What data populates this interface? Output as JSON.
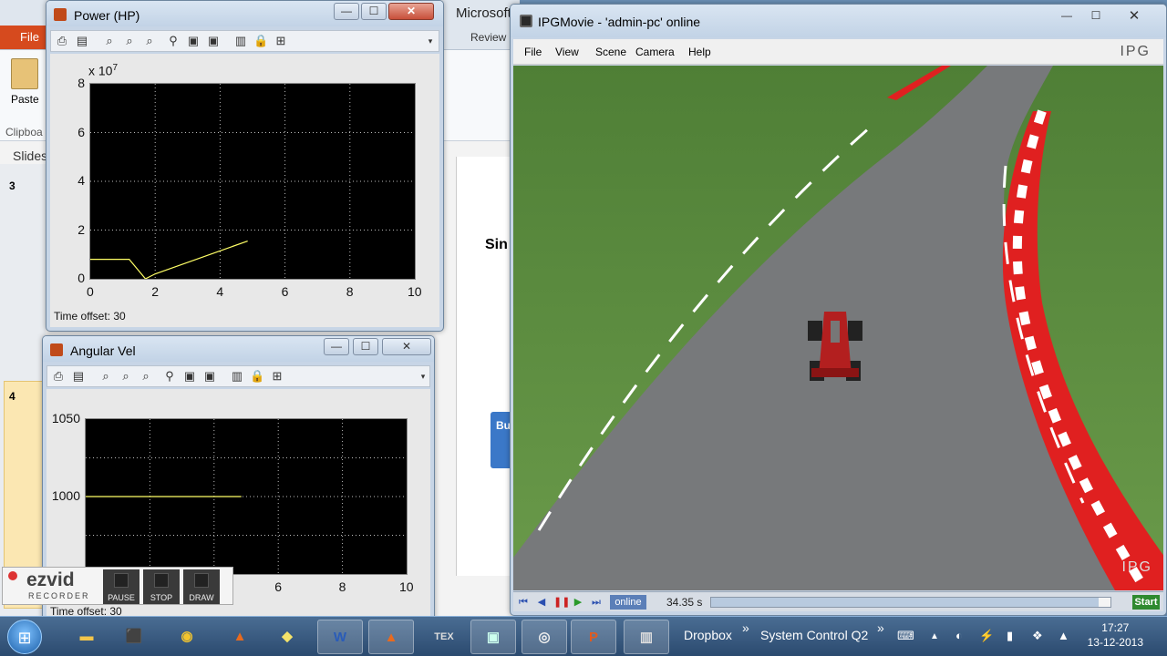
{
  "powerpoint": {
    "title_fragment": "Microsoft",
    "file_tab": "File",
    "review_tab": "Review",
    "paste_label": "Paste",
    "clipboard_group": "Clipboa",
    "slides_panel": "Slides",
    "slide_numbers": [
      "3",
      "4"
    ],
    "slide_heading_fragment": "Sin",
    "selected_box_text": "Bu"
  },
  "power_window": {
    "title": "Power (HP)",
    "exponent_label": "x 10",
    "exponent_power": "7",
    "status": "Time offset:  30",
    "chart_data": {
      "type": "line",
      "title": "",
      "xlabel": "",
      "ylabel": "",
      "xlim": [
        0,
        10
      ],
      "ylim": [
        0,
        8
      ],
      "xticks": [
        "0",
        "2",
        "4",
        "6",
        "8",
        "10"
      ],
      "yticks": [
        "0",
        "2",
        "4",
        "6",
        "8"
      ],
      "grid": true,
      "series": [
        {
          "color": "#ffff66",
          "x": [
            0,
            1.2,
            1.7,
            2.0,
            4.85
          ],
          "y": [
            0.8,
            0.8,
            0.0,
            0.2,
            1.55
          ]
        }
      ]
    }
  },
  "angular_window": {
    "title": "Angular Vel",
    "status": "Time offset:  30",
    "chart_data": {
      "type": "line",
      "title": "",
      "xlabel": "",
      "ylabel": "",
      "xlim": [
        0,
        10
      ],
      "ylim": [
        950,
        1050
      ],
      "xticks": [
        "6",
        "8",
        "10"
      ],
      "yticks": [
        "1000",
        "1050"
      ],
      "grid": true,
      "series": [
        {
          "color": "#ffff66",
          "x": [
            0,
            4.85
          ],
          "y": [
            1000,
            1000
          ]
        }
      ]
    }
  },
  "ipg": {
    "title": "IPGMovie - 'admin-pc' online",
    "menu": [
      "File",
      "View",
      "Scene",
      "Camera",
      "Help"
    ],
    "logo": "IPG",
    "watermark": "IPG",
    "mode": "online",
    "time_value": "34.35",
    "time_unit": "s",
    "progress": 0.97,
    "start_button": "Start"
  },
  "ezvid": {
    "logo": "ezvid",
    "sub": "RECORDER",
    "buttons": [
      "PAUSE",
      "STOP",
      "DRAW"
    ]
  },
  "taskbar": {
    "apps": [
      "Explorer",
      "Acrobat",
      "Chrome",
      "MATLAB",
      "Sticky Notes",
      "Word",
      "MATLAB",
      "TeX",
      "Window",
      "IPG",
      "PowerPoint",
      "Movie"
    ],
    "word_letter": "W",
    "ppt_letter": "P",
    "tex_label": "TEX",
    "toolbar_dropbox": "Dropbox",
    "toolbar_system": "System  Control Q2",
    "chevron": "»",
    "clock_time": "17:27",
    "clock_date": "13-12-2013"
  },
  "colors": {
    "plot_bg": "#000000",
    "trace": "#ffff66",
    "curb_red": "#e02020",
    "grass": "#5b8a3f",
    "road": "#77797b"
  }
}
